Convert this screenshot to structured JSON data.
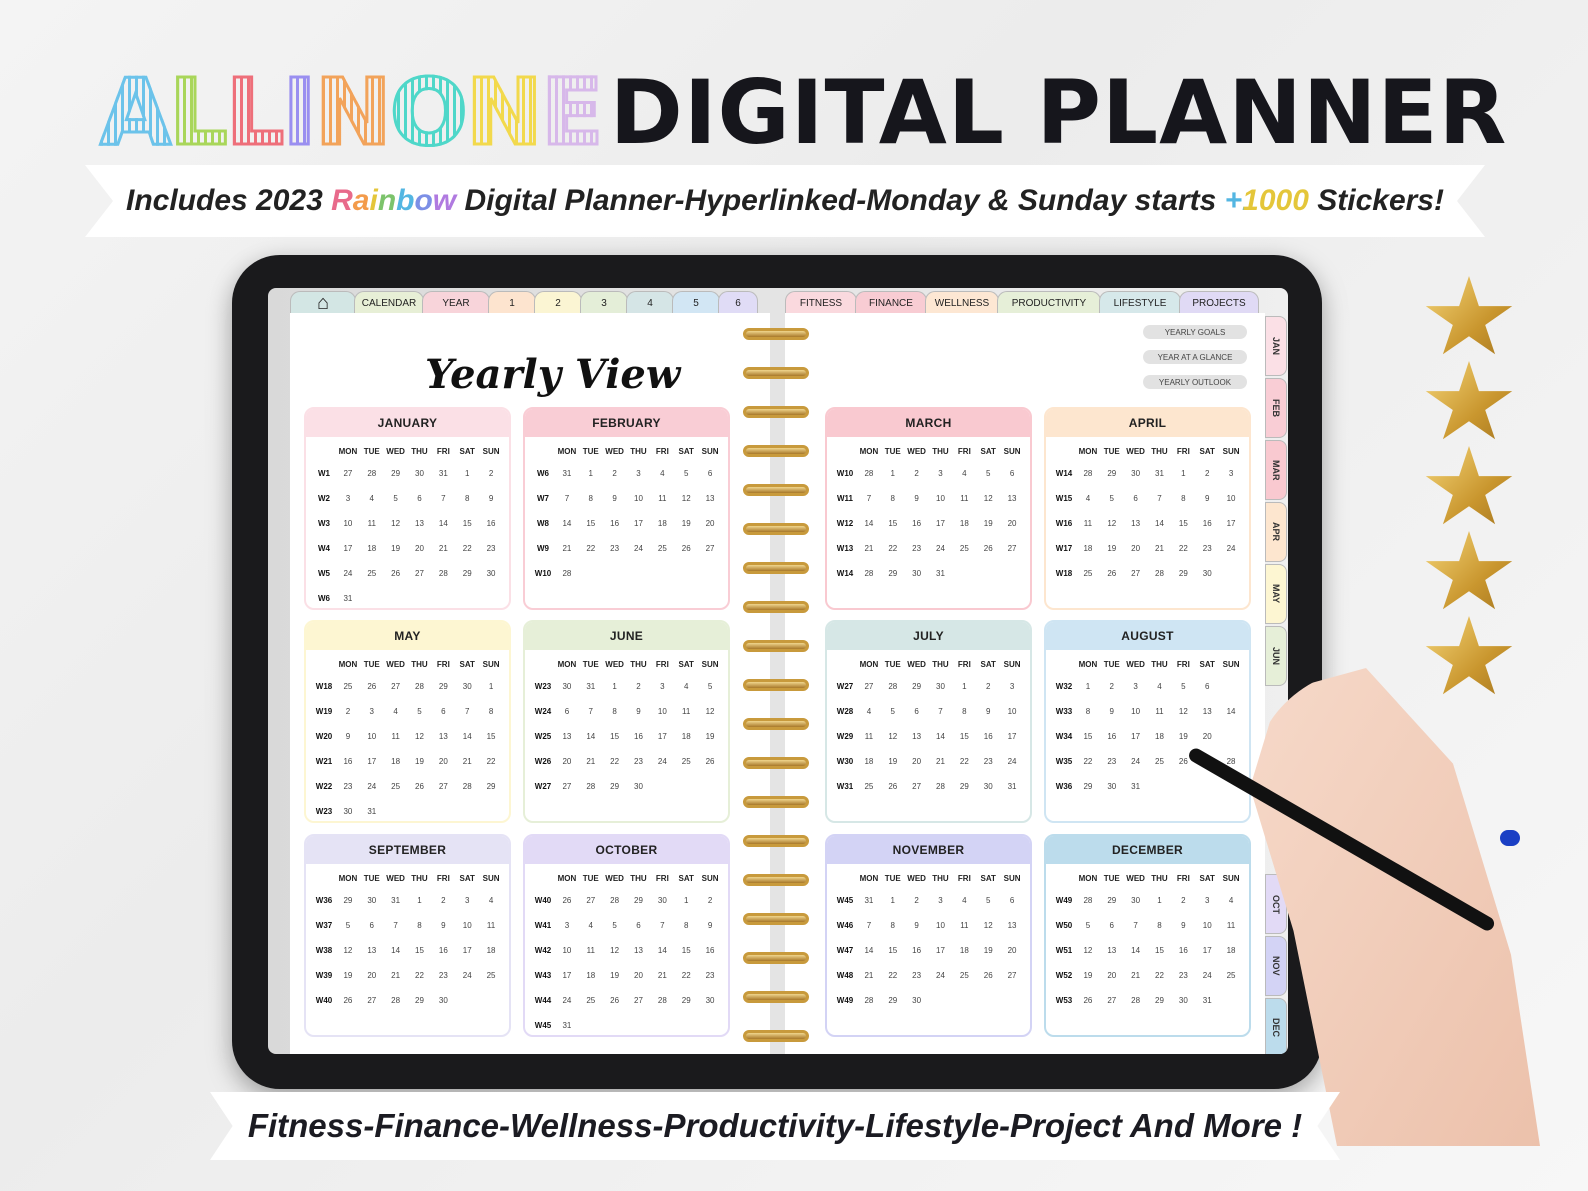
{
  "header": {
    "rainbow_letters": [
      "A",
      "L",
      "L",
      "I",
      "N",
      "O",
      "N",
      "E"
    ],
    "rainbow_colors": [
      "#6cc3ea",
      "#a9d65a",
      "#ee6f7a",
      "#9a8ff0",
      "#f2a35a",
      "#4fd7c9",
      "#f2d94c",
      "#d7b8ea"
    ],
    "title": "DIGITAL PLANNER"
  },
  "subtitle": {
    "pre": "Includes 2023 ",
    "rainbow": "Rainbow",
    "mid": " Digital Planner-Hyperlinked-Monday & Sunday starts ",
    "plus": "+1000",
    "post": " Stickers!"
  },
  "footer": "Fitness-Finance-Wellness-Productivity-Lifestyle-Project And More !",
  "left_tabs": [
    {
      "label": "home-icon",
      "color": "#d3e6e4"
    },
    {
      "label": "CALENDAR",
      "color": "#e7efd6"
    },
    {
      "label": "YEAR",
      "color": "#f8d4da"
    },
    {
      "label": "1",
      "color": "#fde4cf"
    },
    {
      "label": "2",
      "color": "#fbf5d3"
    },
    {
      "label": "3",
      "color": "#e4eed8"
    },
    {
      "label": "4",
      "color": "#d5e5e6"
    },
    {
      "label": "5",
      "color": "#d2e6f4"
    },
    {
      "label": "6",
      "color": "#e0dcf6"
    }
  ],
  "right_tabs": [
    {
      "label": "FITNESS",
      "color": "#fad9de"
    },
    {
      "label": "FINANCE",
      "color": "#f8ccd3"
    },
    {
      "label": "WELLNESS",
      "color": "#fde7d3"
    },
    {
      "label": "PRODUCTIVITY",
      "color": "#e6efd8"
    },
    {
      "label": "LIFESTYLE",
      "color": "#d6e8ea"
    },
    {
      "label": "PROJECTS",
      "color": "#e0daf5"
    }
  ],
  "page_title": "Yearly View",
  "quick_links": [
    "YEARLY GOALS",
    "YEAR AT A GLANCE",
    "YEARLY OUTLOOK"
  ],
  "side_tabs": [
    {
      "label": "JAN",
      "color": "#fbe0e6"
    },
    {
      "label": "FEB",
      "color": "#f9cdd5"
    },
    {
      "label": "MAR",
      "color": "#f9c9d0"
    },
    {
      "label": "APR",
      "color": "#fde6cf"
    },
    {
      "label": "MAY",
      "color": "#fdf6d2"
    },
    {
      "label": "JUN",
      "color": "#e6efd8"
    },
    {
      "label": "OCT",
      "color": "#e2daf6"
    },
    {
      "label": "NOV",
      "color": "#d3d3f5"
    },
    {
      "label": "DEC",
      "color": "#bcdcec"
    }
  ],
  "weekdays": [
    "MON",
    "TUE",
    "WED",
    "THU",
    "FRI",
    "SAT",
    "SUN"
  ],
  "months": [
    {
      "name": "JANUARY",
      "color": "#fbe0e6",
      "rows": [
        "W1 27 28 29 30 31 1 2",
        "W2 3 4 5 6 7 8 9",
        "W3 10 11 12 13 14 15 16",
        "W4 17 18 19 20 21 22 23",
        "W5 24 25 26 27 28 29 30",
        "W6 31"
      ]
    },
    {
      "name": "FEBRUARY",
      "color": "#f9cdd5",
      "rows": [
        "W6 31 1 2 3 4 5 6",
        "W7 7 8 9 10 11 12 13",
        "W8 14 15 16 17 18 19 20",
        "W9 21 22 23 24 25 26 27",
        "W10 28"
      ]
    },
    {
      "name": "MARCH",
      "color": "#f9c9d0",
      "rows": [
        "W10 28 1 2 3 4 5 6",
        "W11 7 8 9 10 11 12 13",
        "W12 14 15 16 17 18 19 20",
        "W13 21 22 23 24 25 26 27",
        "W14 28 29 30 31"
      ]
    },
    {
      "name": "APRIL",
      "color": "#fde6cf",
      "rows": [
        "W14 28 29 30 31 1 2 3",
        "W15 4 5 6 7 8 9 10",
        "W16 11 12 13 14 15 16 17",
        "W17 18 19 20 21 22 23 24",
        "W18 25 26 27 28 29 30"
      ]
    },
    {
      "name": "MAY",
      "color": "#fdf6d2",
      "rows": [
        "W18 25 26 27 28 29 30 1",
        "W19 2 3 4 5 6 7 8",
        "W20 9 10 11 12 13 14 15",
        "W21 16 17 18 19 20 21 22",
        "W22 23 24 25 26 27 28 29",
        "W23 30 31"
      ]
    },
    {
      "name": "JUNE",
      "color": "#e6efd8",
      "rows": [
        "W23 30 31 1 2 3 4 5",
        "W24 6 7 8 9 10 11 12",
        "W25 13 14 15 16 17 18 19",
        "W26 20 21 22 23 24 25 26",
        "W27 27 28 29 30"
      ]
    },
    {
      "name": "JULY",
      "color": "#d6e7e6",
      "rows": [
        "W27 27 28 29 30 1 2 3",
        "W28 4 5 6 7 8 9 10",
        "W29 11 12 13 14 15 16 17",
        "W30 18 19 20 21 22 23 24",
        "W31 25 26 27 28 29 30 31"
      ]
    },
    {
      "name": "AUGUST",
      "color": "#cfe5f3",
      "rows": [
        "W32 1 2 3 4 5 6",
        "W33 8 9 10 11 12 13 14",
        "W34 15 16 17 18 19 20",
        "W35 22 23 24 25 26 27 28",
        "W36 29 30 31"
      ]
    },
    {
      "name": "SEPTEMBER",
      "color": "#e5e3f5",
      "rows": [
        "W36 29 30 31 1 2 3 4",
        "W37 5 6 7 8 9 10 11",
        "W38 12 13 14 15 16 17 18",
        "W39 19 20 21 22 23 24 25",
        "W40 26 27 28 29 30"
      ]
    },
    {
      "name": "OCTOBER",
      "color": "#e2daf6",
      "rows": [
        "W40 26 27 28 29 30 1 2",
        "W41 3 4 5 6 7 8 9",
        "W42 10 11 12 13 14 15 16",
        "W43 17 18 19 20 21 22 23",
        "W44 24 25 26 27 28 29 30",
        "W45 31"
      ]
    },
    {
      "name": "NOVEMBER",
      "color": "#d3d3f5",
      "rows": [
        "W45 31 1 2 3 4 5 6",
        "W46 7 8 9 10 11 12 13",
        "W47 14 15 16 17 18 19 20",
        "W48 21 22 23 24 25 26 27",
        "W49 28 29 30"
      ]
    },
    {
      "name": "DECEMBER",
      "color": "#bcdcec",
      "rows": [
        "W49 28 29 30 1 2 3 4",
        "W50 5 6 7 8 9 10 11",
        "W51 12 13 14 15 16 17 18",
        "W52 19 20 21 22 23 24 25",
        "W53 26 27 28 29 30 31"
      ]
    }
  ],
  "rating": {
    "stars": 5
  }
}
